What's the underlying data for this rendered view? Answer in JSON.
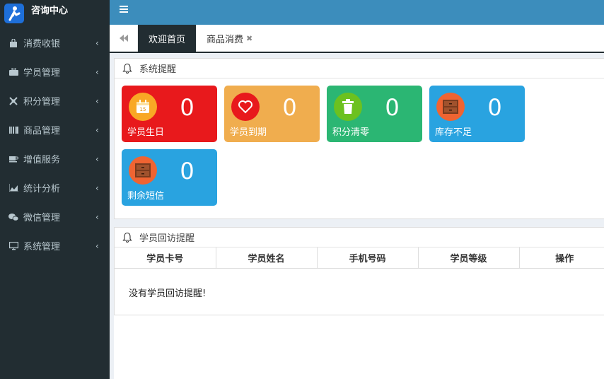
{
  "brand": {
    "title": "咨询中心"
  },
  "sidebar": {
    "items": [
      {
        "label": "消费收银",
        "icon": "bag-icon"
      },
      {
        "label": "学员管理",
        "icon": "briefcase-icon"
      },
      {
        "label": "积分管理",
        "icon": "cog-icon"
      },
      {
        "label": "商品管理",
        "icon": "barcode-icon"
      },
      {
        "label": "增值服务",
        "icon": "coffee-icon"
      },
      {
        "label": "统计分析",
        "icon": "area-chart-icon"
      },
      {
        "label": "微信管理",
        "icon": "wechat-icon"
      },
      {
        "label": "系统管理",
        "icon": "desktop-icon"
      }
    ],
    "chevron": "‹"
  },
  "tabs": [
    {
      "label": "欢迎首页",
      "active": true
    },
    {
      "label": "商品消费",
      "active": false,
      "close": "✖"
    }
  ],
  "reminder_panel": {
    "title": "系统提醒",
    "cards": [
      {
        "value": "0",
        "label": "学员生日",
        "color": "#e8191c",
        "icon_bg": "#f9a825",
        "icon": "calendar-icon"
      },
      {
        "value": "0",
        "label": "学员到期",
        "color": "#f0ad4e",
        "icon_bg": "#e8191c",
        "icon": "heart-icon"
      },
      {
        "value": "0",
        "label": "积分清零",
        "color": "#2bb673",
        "icon_bg": "#6cc11f",
        "icon": "trash-icon"
      },
      {
        "value": "0",
        "label": "库存不足",
        "color": "#29a3e0",
        "icon_bg": "#ef6432",
        "icon": "drawer-icon"
      },
      {
        "value": "0",
        "label": "剩余短信",
        "color": "#29a3e0",
        "icon_bg": "#ef6432",
        "icon": "drawer-icon"
      }
    ]
  },
  "visit_panel": {
    "title": "学员回访提醒",
    "columns": [
      "学员卡号",
      "学员姓名",
      "手机号码",
      "学员等级",
      "操作"
    ],
    "empty_message": "没有学员回访提醒!"
  }
}
